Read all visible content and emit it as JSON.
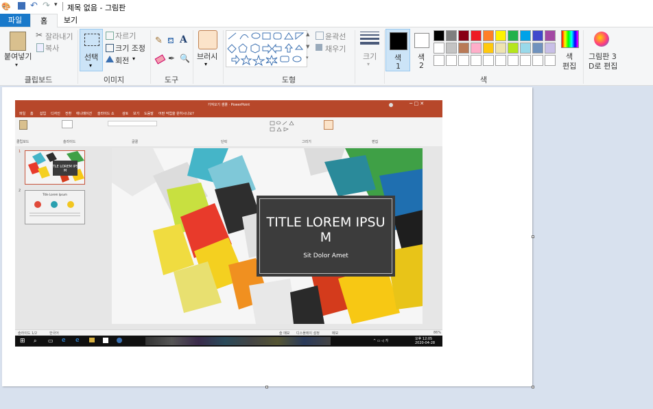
{
  "window": {
    "title": "제목 없음 - 그림판"
  },
  "tabs": {
    "file": "파일",
    "home": "홈",
    "view": "보기"
  },
  "ribbon": {
    "clipboard": {
      "paste": "붙여넣기",
      "cut": "잘라내기",
      "copy": "복사",
      "label": "클립보드"
    },
    "image": {
      "select": "선택",
      "crop": "자르기",
      "resize": "크기 조정",
      "rotate": "회전",
      "label": "이미지"
    },
    "tools": {
      "label": "도구"
    },
    "brushes": {
      "label": "브러시"
    },
    "shapes": {
      "outline": "윤곽선",
      "fill": "채우기",
      "label": "도형"
    },
    "size": {
      "label": "크기"
    },
    "colors": {
      "color1": "색\n1",
      "color1_a": "색",
      "color1_b": "1",
      "color2_a": "색",
      "color2_b": "2",
      "edit": "색\n편집",
      "edit_a": "색",
      "edit_b": "편집",
      "label": "색",
      "palette_row1": [
        "#000000",
        "#7f7f7f",
        "#880015",
        "#ed1c24",
        "#ff7f27",
        "#fff200",
        "#22b14c",
        "#00a2e8",
        "#3f48cc",
        "#a349a4"
      ],
      "palette_row2": [
        "#ffffff",
        "#c3c3c3",
        "#b97a57",
        "#ffaec9",
        "#ffc90e",
        "#efe4b0",
        "#b5e61d",
        "#99d9ea",
        "#7092be",
        "#c8bfe7"
      ],
      "palette_row3": [
        "#ffffff",
        "#ffffff",
        "#ffffff",
        "#ffffff",
        "#ffffff",
        "#ffffff",
        "#ffffff",
        "#ffffff",
        "#ffffff",
        "#ffffff"
      ]
    },
    "paint3d": {
      "a": "그림판 3",
      "b": "D로 편집"
    }
  },
  "ppt": {
    "window_title": "가져오기 샘플 · PowerPoint",
    "tabs": [
      "파일",
      "홈",
      "삽입",
      "디자인",
      "전환",
      "애니메이션",
      "슬라이드 쇼",
      "검토",
      "보기",
      "도움말",
      "어떤 작업을 원하시나요?"
    ],
    "ribbon_groups": [
      "클립보드",
      "슬라이드",
      "글꼴",
      "단락",
      "그리기",
      "편집"
    ],
    "slide_title": "TITLE LOREM IPSUM",
    "slide_title_a": "TITLE LOREM IPSU",
    "slide_title_b": "M",
    "slide_subtitle": "Sit Dolor Amet",
    "thumb2_title": "Title Lorem Ipsum",
    "status_left": "슬라이드 1/2",
    "status_lang": "한국어",
    "status_notes": "슬 메모",
    "status_display": "디스플레이 설정",
    "status_comments": "메모",
    "status_zoom": "86%",
    "clock_time": "오후 12:05",
    "clock_date": "2020-04-28",
    "thumb_nums": [
      "1",
      "2"
    ]
  }
}
